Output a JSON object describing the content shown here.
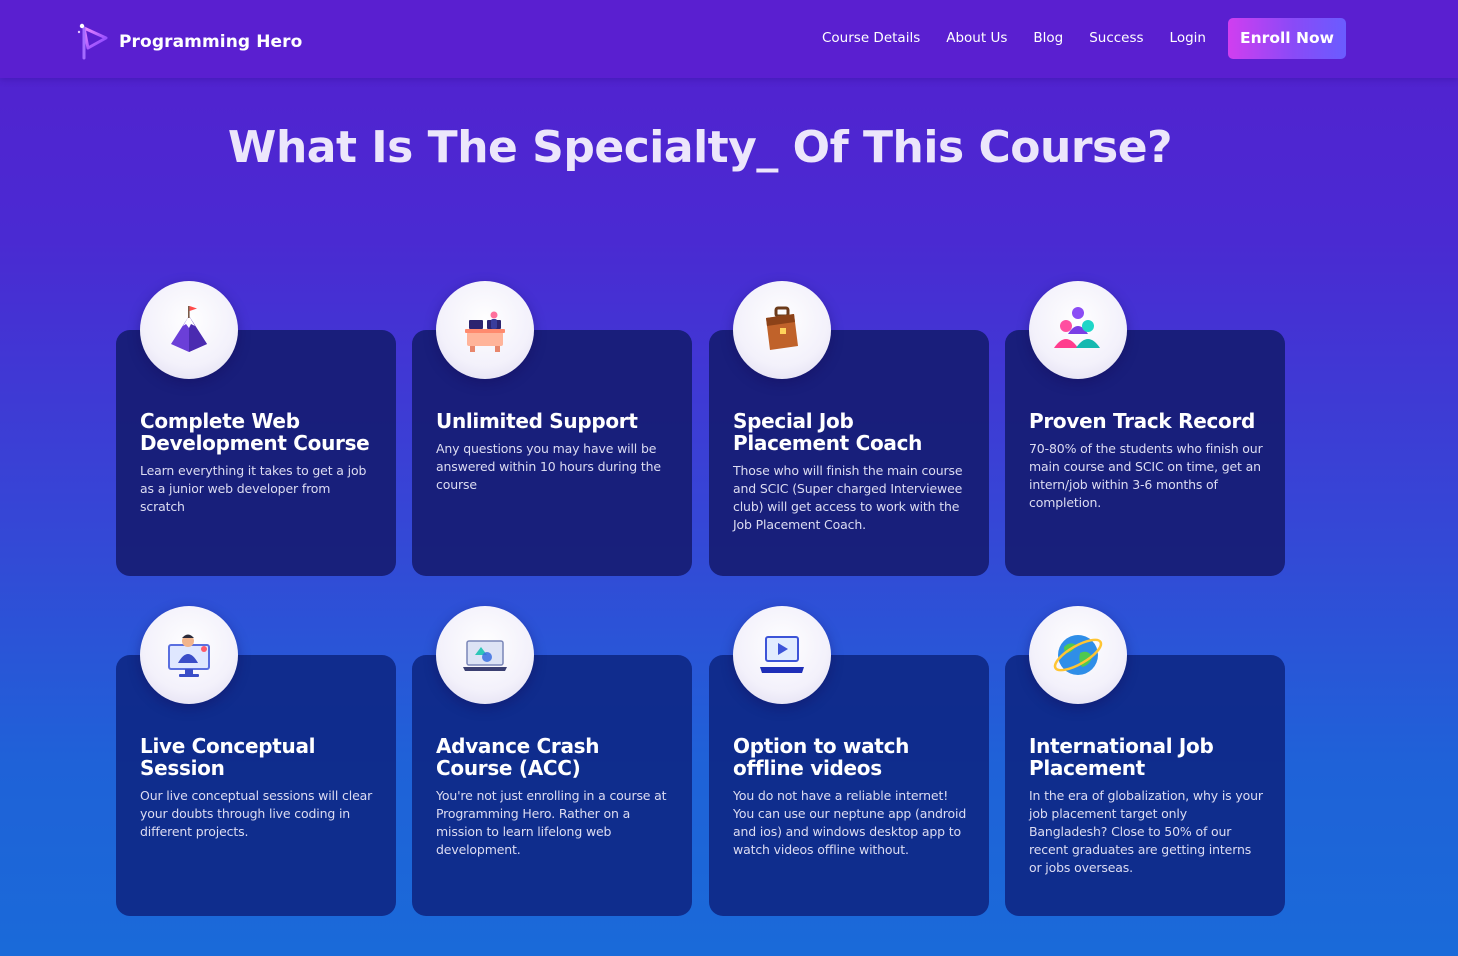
{
  "nav": {
    "brand": "Programming Hero",
    "links": [
      "Course Details",
      "About Us",
      "Blog",
      "Success",
      "Login"
    ],
    "cta": "Enroll Now"
  },
  "section": {
    "title": "What Is The Specialty_ Of This Course?"
  },
  "cards": [
    {
      "icon": "mountain-flag-icon",
      "title": "Complete Web Development Course",
      "text": "Learn everything it takes to get a job as a junior web developer from scratch"
    },
    {
      "icon": "support-desk-icon",
      "title": "Unlimited Support",
      "text": "Any questions you may have will be answered within 10 hours during the course"
    },
    {
      "icon": "briefcase-icon",
      "title": "Special Job Placement Coach",
      "text": "Those who will finish the main course and SCIC (Super charged Interviewee club) will get access to work with the Job Placement Coach."
    },
    {
      "icon": "people-group-icon",
      "title": "Proven Track Record",
      "text": "70-80% of the students who finish our main course and SCIC on time, get an intern/job within 3-6 months of completion."
    },
    {
      "icon": "live-session-icon",
      "title": "Live Conceptual Session",
      "text": "Our live conceptual sessions will clear your doubts through live coding in different projects."
    },
    {
      "icon": "laptop-shapes-icon",
      "title": "Advance Crash Course (ACC)",
      "text": "You're not just enrolling in a course at Programming Hero. Rather on a mission to learn lifelong web development."
    },
    {
      "icon": "video-play-icon",
      "title": "Option to watch offline videos",
      "text": "You do not have a reliable internet! You can use our neptune app (android and ios) and windows desktop app to watch videos offline without."
    },
    {
      "icon": "globe-icon",
      "title": "International Job Placement",
      "text": "In the era of globalization, why is your job placement target only Bangladesh? Close to 50% of our recent graduates are getting interns or jobs overseas."
    }
  ]
}
